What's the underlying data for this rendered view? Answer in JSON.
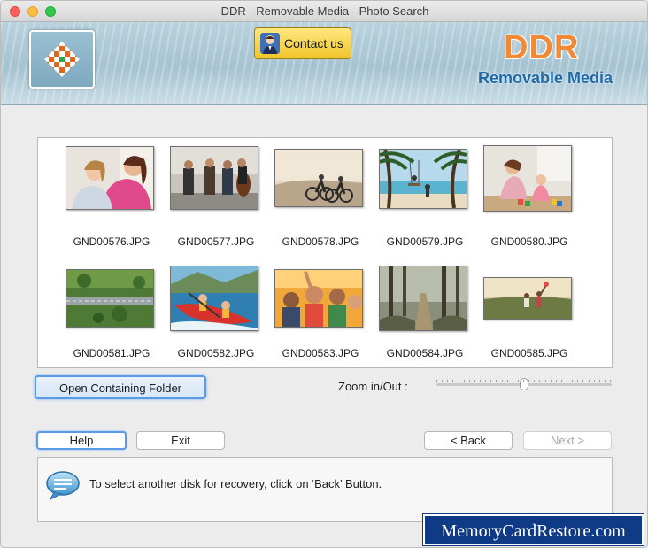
{
  "window": {
    "title": "DDR - Removable Media - Photo Search"
  },
  "header": {
    "contact_label": "Contact us",
    "brand_title": "DDR",
    "brand_subtitle": "Removable Media"
  },
  "gallery": {
    "items": [
      {
        "filename": "GND00576.JPG",
        "scene": "mother-daughter"
      },
      {
        "filename": "GND00577.JPG",
        "scene": "street-musicians"
      },
      {
        "filename": "GND00578.JPG",
        "scene": "cyclists"
      },
      {
        "filename": "GND00579.JPG",
        "scene": "beach-swing"
      },
      {
        "filename": "GND00580.JPG",
        "scene": "kids-toys"
      },
      {
        "filename": "GND00581.JPG",
        "scene": "aerial-road"
      },
      {
        "filename": "GND00582.JPG",
        "scene": "kayak"
      },
      {
        "filename": "GND00583.JPG",
        "scene": "crowd"
      },
      {
        "filename": "GND00584.JPG",
        "scene": "forest"
      },
      {
        "filename": "GND00585.JPG",
        "scene": "kids-field"
      }
    ]
  },
  "controls": {
    "open_folder_label": "Open Containing Folder",
    "zoom_label": "Zoom in/Out :",
    "zoom_level": 0.5
  },
  "nav": {
    "help_label": "Help",
    "exit_label": "Exit",
    "back_label": "< Back",
    "next_label": "Next >"
  },
  "status": {
    "message": "To select another disk for recovery, click on ‘Back’ Button."
  },
  "watermark": {
    "text": "MemoryCardRestore.com"
  },
  "colors": {
    "brand_orange": "#f08a37",
    "brand_blue": "#1e6aa8",
    "focus_blue": "#5a9be8",
    "watermark_bg": "#0e3a86"
  }
}
